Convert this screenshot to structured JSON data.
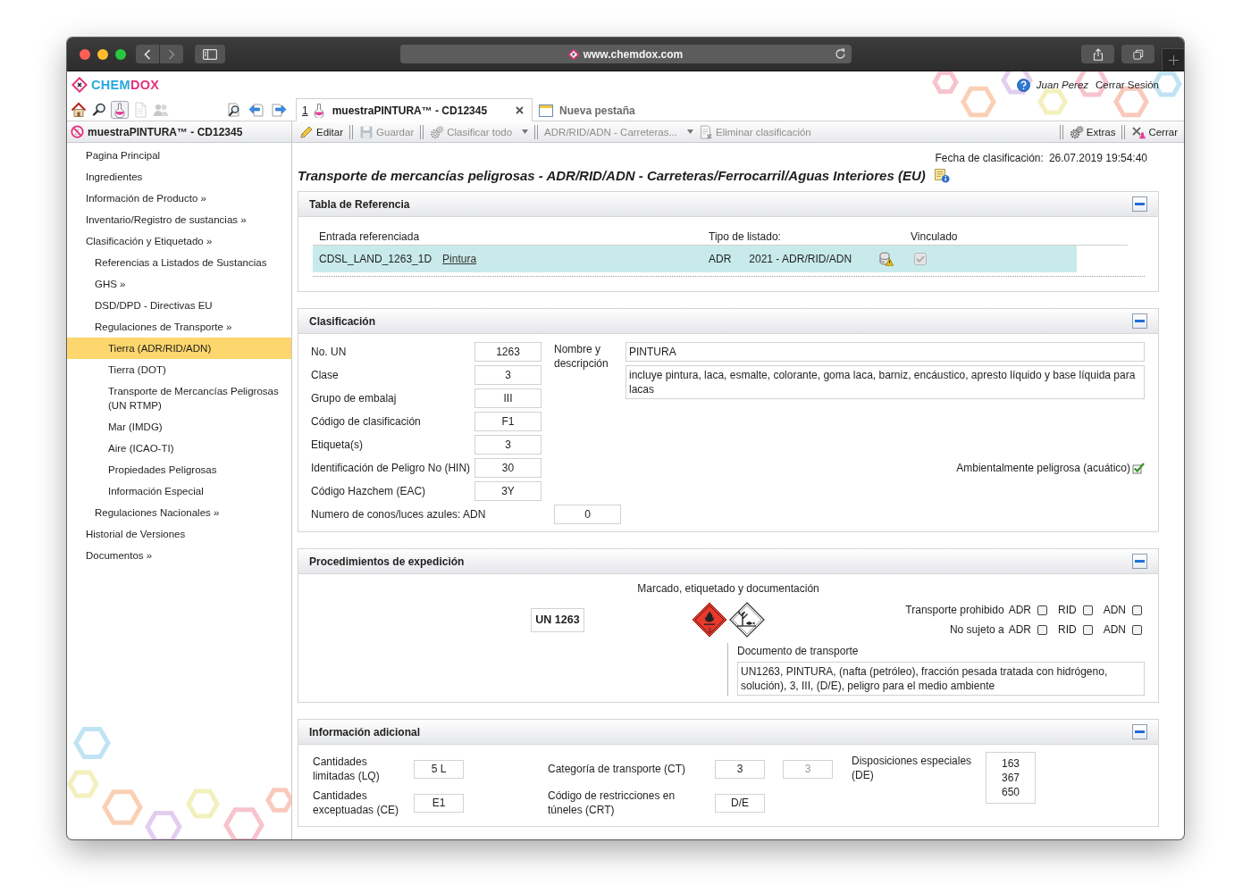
{
  "browser": {
    "url": "www.chemdox.com"
  },
  "header": {
    "logo": [
      {
        "text": "CHEM",
        "color": "#27a8e0"
      },
      {
        "text": "DOX",
        "color": "#e5327e"
      }
    ],
    "user": "Juan Perez",
    "logout": "Cerrar Sesión"
  },
  "nav_tools": [
    {
      "kind": "home",
      "selected": false,
      "disabled": false
    },
    {
      "kind": "search",
      "selected": false,
      "disabled": false
    },
    {
      "kind": "flask",
      "selected": true,
      "disabled": false
    },
    {
      "kind": "document",
      "selected": false,
      "disabled": true
    },
    {
      "kind": "people",
      "selected": false,
      "disabled": true
    }
  ],
  "panel_tools": [
    {
      "kind": "find"
    },
    {
      "kind": "back"
    },
    {
      "kind": "forward"
    }
  ],
  "tabs": [
    {
      "kind": "record",
      "number": "1",
      "label": "muestraPINTURA™ - CD12345",
      "selected": true,
      "closable": true
    },
    {
      "kind": "new",
      "label": "Nueva pestaña",
      "selected": false,
      "closable": false
    }
  ],
  "record_title": "muestraPINTURA™ - CD12345",
  "toolbar": {
    "groups": [
      {
        "items": [
          {
            "kind": "edit",
            "label": "Editar",
            "disabled": false,
            "dropdown": false
          }
        ]
      },
      {
        "items": [
          {
            "kind": "save",
            "label": "Guardar",
            "disabled": true,
            "dropdown": false
          }
        ]
      },
      {
        "items": [
          {
            "kind": "classify",
            "label": "Clasificar todo",
            "disabled": true,
            "dropdown": true
          }
        ]
      },
      {
        "items": [
          {
            "kind": "regulation",
            "label": "ADR/RID/ADN - Carreteras...",
            "disabled": true,
            "dropdown": true
          },
          {
            "kind": "remove",
            "label": "Eliminar clasificación",
            "disabled": true,
            "dropdown": false
          }
        ]
      }
    ]
  },
  "toolbar_right": {
    "groups": [
      {
        "items": [
          {
            "kind": "extras",
            "label": "Extras",
            "disabled": false,
            "dropdown": false
          }
        ]
      },
      {
        "items": [
          {
            "kind": "close",
            "label": "Cerrar",
            "disabled": false,
            "dropdown": false
          }
        ]
      }
    ]
  },
  "sidebar": {
    "items": [
      {
        "label": "Pagina Principal",
        "selected": false
      },
      {
        "label": "Ingredientes",
        "selected": false
      },
      {
        "label": "Información de Producto »",
        "selected": false
      },
      {
        "label": "Inventario/Registro de sustancias »",
        "selected": false
      },
      {
        "label": "Clasificación y Etiquetado »",
        "selected": false,
        "children": [
          {
            "label": "Referencias a Listados de Sustancias",
            "selected": false
          },
          {
            "label": "GHS »",
            "selected": false
          },
          {
            "label": "DSD/DPD - Directivas EU",
            "selected": false
          },
          {
            "label": "Regulaciones de Transporte »",
            "selected": false,
            "children": [
              {
                "label": "Tierra (ADR/RID/ADN)",
                "selected": true
              },
              {
                "label": "Tierra (DOT)",
                "selected": false
              },
              {
                "label": "Transporte de Mercancías Peligrosas (UN RTMP)",
                "selected": false
              },
              {
                "label": "Mar (IMDG)",
                "selected": false
              },
              {
                "label": "Aire (ICAO-TI)",
                "selected": false
              },
              {
                "label": "Propiedades Peligrosas",
                "selected": false
              },
              {
                "label": "Información Especial",
                "selected": false
              }
            ]
          },
          {
            "label": "Regulaciones Nacionales »",
            "selected": false
          }
        ]
      },
      {
        "label": "Historial de Versiones",
        "selected": false
      },
      {
        "label": "Documentos »",
        "selected": false
      }
    ]
  },
  "content": {
    "classification_date": {
      "label": "Fecha de clasificación:",
      "value": "26.07.2019 19:54:40"
    },
    "title": "Transporte de mercancías peligrosas - ADR/RID/ADN - Carreteras/Ferrocarril/Aguas Interiores (EU)",
    "reference_table": {
      "title": "Tabla de Referencia",
      "expanded": true,
      "columns": [
        "Entrada referenciada",
        "Tipo de listado:",
        "Vinculado"
      ],
      "rows": [
        {
          "entry": "CDSL_LAND_1263_1D",
          "link": "Pintura",
          "list_code": "ADR",
          "list_name": "2021 - ADR/RID/ADN",
          "warning": true,
          "linked": true,
          "selected": true
        }
      ]
    },
    "classification": {
      "title": "Clasificación",
      "expanded": true,
      "fields": [
        {
          "label": "No. UN",
          "value": "1263"
        },
        {
          "label": "Clase",
          "value": "3"
        },
        {
          "label": "Grupo de embalaj",
          "value": "III"
        },
        {
          "label": "Código de clasificación",
          "value": "F1"
        },
        {
          "label": "Etiqueta(s)",
          "value": "3"
        },
        {
          "label": "Identificación de Peligro No (HIN)",
          "value": "30"
        },
        {
          "label": "Código Hazchem (EAC)",
          "value": "3Y"
        }
      ],
      "cones": {
        "label": "Numero de conos/luces azules: ADN",
        "value": "0"
      },
      "name_label": "Nombre y descripción",
      "name": "PINTURA",
      "description": "incluye pintura, laca, esmalte, colorante, goma laca, barniz, encáustico, apresto líquido y base líquida para lacas",
      "environmental": {
        "label": "Ambientalmente peligrosa (acuático)",
        "checked": true
      }
    },
    "shipping": {
      "title": "Procedimientos de expedición",
      "expanded": true,
      "heading": "Marcado, etiquetado y documentación",
      "un_number": "UN 1263",
      "hazard_labels": [
        {
          "kind": "flammable",
          "number": "3"
        },
        {
          "kind": "environment"
        }
      ],
      "restrictions": [
        {
          "label": "Transporte prohibido",
          "options": [
            {
              "label": "ADR",
              "checked": false
            },
            {
              "label": "RID",
              "checked": false
            },
            {
              "label": "ADN",
              "checked": false
            }
          ]
        },
        {
          "label": "No sujeto a",
          "options": [
            {
              "label": "ADR",
              "checked": false
            },
            {
              "label": "RID",
              "checked": false
            },
            {
              "label": "ADN",
              "checked": false
            }
          ]
        }
      ],
      "document": {
        "label": "Documento de transporte",
        "value": "UN1263, PINTURA, (nafta (petróleo), fracción pesada tratada con hidrógeno, solución), 3, III, (D/E), peligro para el medio ambiente"
      }
    },
    "additional": {
      "title": "Información adicional",
      "expanded": true,
      "limited_quantities": {
        "label": "Cantidades limitadas (LQ)",
        "value": "5 L"
      },
      "excepted_quantities": {
        "label": "Cantidades exceptuadas (CE)",
        "value": "E1"
      },
      "transport_category": {
        "label": "Categoría de transporte (CT)",
        "value": "3",
        "secondary": {
          "value": "3",
          "disabled": true
        }
      },
      "tunnel_code": {
        "label": "Código de restricciones en túneles (CRT)",
        "value": "D/E"
      },
      "special_provisions": {
        "label": "Disposiciones especiales (DE)",
        "values": [
          "163",
          "367",
          "650"
        ]
      }
    }
  }
}
